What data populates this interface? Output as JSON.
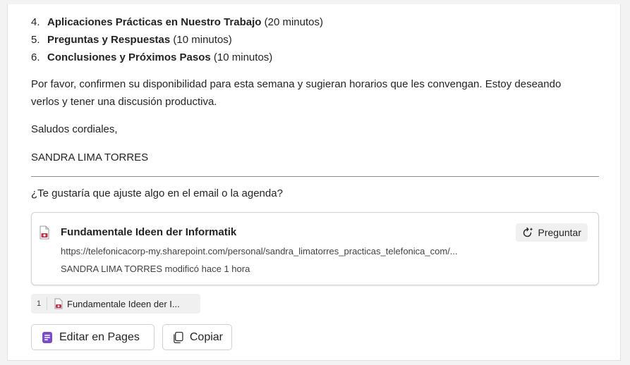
{
  "agenda": [
    {
      "num": "4.",
      "title": "Aplicaciones Prácticas en Nuestro Trabajo",
      "duration": " (20 minutos)"
    },
    {
      "num": "5.",
      "title": "Preguntas y Respuestas",
      "duration": " (10 minutos)"
    },
    {
      "num": "6.",
      "title": "Conclusiones y Próximos Pasos",
      "duration": " (10 minutos)"
    }
  ],
  "body": {
    "availability": "Por favor, confirmen su disponibilidad para esta semana y sugieran horarios que les convengan. Estoy deseando verlos y tener una discusión productiva.",
    "closing": "Saludos cordiales,",
    "signature": "SANDRA LIMA TORRES"
  },
  "followup_question": "¿Te gustaría que ajuste algo en el email o la agenda?",
  "file_card": {
    "title": "Fundamentale Ideen der Informatik",
    "url": "https://telefonicacorp-my.sharepoint.com/personal/sandra_limatorres_practicas_telefonica_com/...",
    "modified": "SANDRA LIMA TORRES modificó hace 1 hora",
    "ask_label": "Preguntar",
    "icon": "pdf-file-icon"
  },
  "reference": {
    "number": "1",
    "label": "Fundamentale Ideen der I..."
  },
  "actions": {
    "edit_pages": "Editar en Pages",
    "copy": "Copiar"
  },
  "colors": {
    "pages_purple": "#7b4cc9",
    "pdf_red": "#c4314b"
  }
}
